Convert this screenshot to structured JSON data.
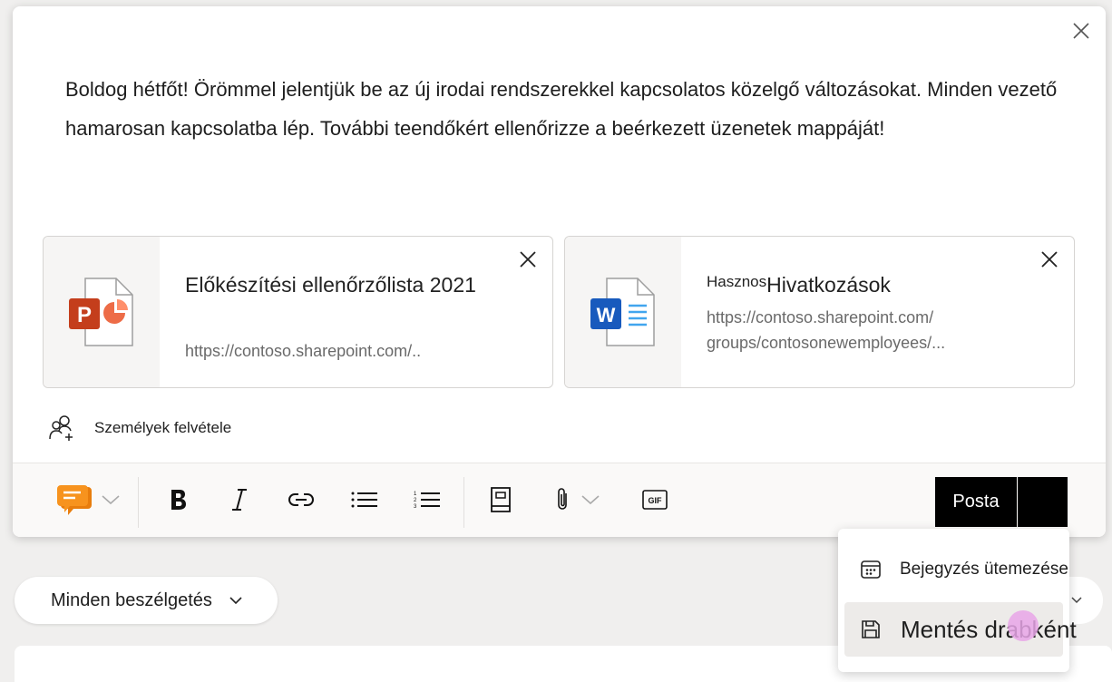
{
  "composer": {
    "message": "Boldog hétfőt! Örömmel jelentjük be az új irodai rendszerekkel kapcsolatos közelgő változásokat. Minden vezető hamarosan kapcsolatba lép. További teendőkért ellenőrizze a beérkezett üzenetek mappáját!",
    "attachments": [
      {
        "icon": "powerpoint-file-icon",
        "title": "Előkészítési ellenőrzőlista 2021",
        "url": "https://contoso.sharepoint.com/.."
      },
      {
        "icon": "word-file-icon",
        "title_small": "Hasznos",
        "title": "Hivatkozások",
        "url_line1": "https://contoso.sharepoint.com/",
        "url_line2": "groups/contosonewemployees/..."
      }
    ],
    "add_people_label": "Személyek felvétele",
    "toolbar": {
      "items": [
        "praise-icon",
        "bold-icon",
        "italic-icon",
        "link-icon",
        "bulleted-list-icon",
        "numbered-list-icon",
        "sticker-book-icon",
        "attach-icon",
        "gif-icon"
      ],
      "gif_text": "GIF",
      "post_label": "Posta"
    }
  },
  "filter": {
    "label": "Minden beszélgetés"
  },
  "post_menu": {
    "items": [
      {
        "icon": "calendar-icon",
        "label": "Bejegyzés ütemezése"
      },
      {
        "icon": "save-icon",
        "label": "Mentés drabként"
      }
    ]
  },
  "colors": {
    "accent_orange": "#f7931e",
    "powerpoint": "#c43e1c",
    "word": "#185abd",
    "post_button": "#000000"
  }
}
